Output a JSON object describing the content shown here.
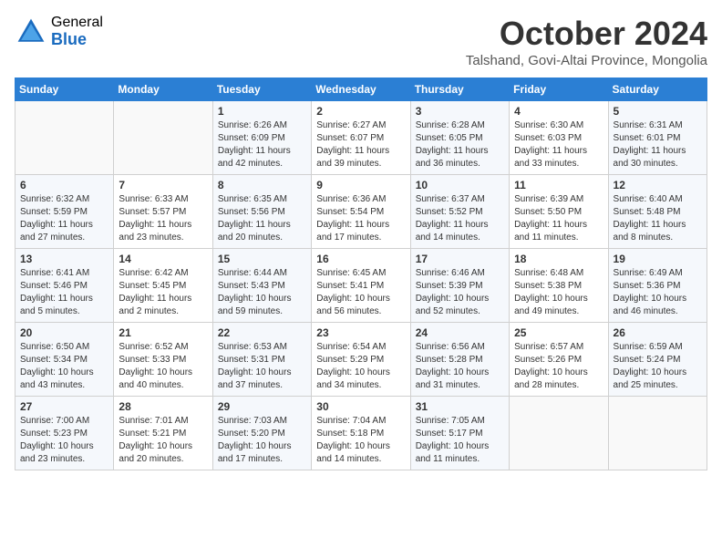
{
  "logo": {
    "general": "General",
    "blue": "Blue"
  },
  "title": "October 2024",
  "location": "Talshand, Govi-Altai Province, Mongolia",
  "headers": [
    "Sunday",
    "Monday",
    "Tuesday",
    "Wednesday",
    "Thursday",
    "Friday",
    "Saturday"
  ],
  "weeks": [
    [
      {
        "day": "",
        "info": ""
      },
      {
        "day": "",
        "info": ""
      },
      {
        "day": "1",
        "sunrise": "6:26 AM",
        "sunset": "6:09 PM",
        "daylight": "11 hours and 42 minutes."
      },
      {
        "day": "2",
        "sunrise": "6:27 AM",
        "sunset": "6:07 PM",
        "daylight": "11 hours and 39 minutes."
      },
      {
        "day": "3",
        "sunrise": "6:28 AM",
        "sunset": "6:05 PM",
        "daylight": "11 hours and 36 minutes."
      },
      {
        "day": "4",
        "sunrise": "6:30 AM",
        "sunset": "6:03 PM",
        "daylight": "11 hours and 33 minutes."
      },
      {
        "day": "5",
        "sunrise": "6:31 AM",
        "sunset": "6:01 PM",
        "daylight": "11 hours and 30 minutes."
      }
    ],
    [
      {
        "day": "6",
        "sunrise": "6:32 AM",
        "sunset": "5:59 PM",
        "daylight": "11 hours and 27 minutes."
      },
      {
        "day": "7",
        "sunrise": "6:33 AM",
        "sunset": "5:57 PM",
        "daylight": "11 hours and 23 minutes."
      },
      {
        "day": "8",
        "sunrise": "6:35 AM",
        "sunset": "5:56 PM",
        "daylight": "11 hours and 20 minutes."
      },
      {
        "day": "9",
        "sunrise": "6:36 AM",
        "sunset": "5:54 PM",
        "daylight": "11 hours and 17 minutes."
      },
      {
        "day": "10",
        "sunrise": "6:37 AM",
        "sunset": "5:52 PM",
        "daylight": "11 hours and 14 minutes."
      },
      {
        "day": "11",
        "sunrise": "6:39 AM",
        "sunset": "5:50 PM",
        "daylight": "11 hours and 11 minutes."
      },
      {
        "day": "12",
        "sunrise": "6:40 AM",
        "sunset": "5:48 PM",
        "daylight": "11 hours and 8 minutes."
      }
    ],
    [
      {
        "day": "13",
        "sunrise": "6:41 AM",
        "sunset": "5:46 PM",
        "daylight": "11 hours and 5 minutes."
      },
      {
        "day": "14",
        "sunrise": "6:42 AM",
        "sunset": "5:45 PM",
        "daylight": "11 hours and 2 minutes."
      },
      {
        "day": "15",
        "sunrise": "6:44 AM",
        "sunset": "5:43 PM",
        "daylight": "10 hours and 59 minutes."
      },
      {
        "day": "16",
        "sunrise": "6:45 AM",
        "sunset": "5:41 PM",
        "daylight": "10 hours and 56 minutes."
      },
      {
        "day": "17",
        "sunrise": "6:46 AM",
        "sunset": "5:39 PM",
        "daylight": "10 hours and 52 minutes."
      },
      {
        "day": "18",
        "sunrise": "6:48 AM",
        "sunset": "5:38 PM",
        "daylight": "10 hours and 49 minutes."
      },
      {
        "day": "19",
        "sunrise": "6:49 AM",
        "sunset": "5:36 PM",
        "daylight": "10 hours and 46 minutes."
      }
    ],
    [
      {
        "day": "20",
        "sunrise": "6:50 AM",
        "sunset": "5:34 PM",
        "daylight": "10 hours and 43 minutes."
      },
      {
        "day": "21",
        "sunrise": "6:52 AM",
        "sunset": "5:33 PM",
        "daylight": "10 hours and 40 minutes."
      },
      {
        "day": "22",
        "sunrise": "6:53 AM",
        "sunset": "5:31 PM",
        "daylight": "10 hours and 37 minutes."
      },
      {
        "day": "23",
        "sunrise": "6:54 AM",
        "sunset": "5:29 PM",
        "daylight": "10 hours and 34 minutes."
      },
      {
        "day": "24",
        "sunrise": "6:56 AM",
        "sunset": "5:28 PM",
        "daylight": "10 hours and 31 minutes."
      },
      {
        "day": "25",
        "sunrise": "6:57 AM",
        "sunset": "5:26 PM",
        "daylight": "10 hours and 28 minutes."
      },
      {
        "day": "26",
        "sunrise": "6:59 AM",
        "sunset": "5:24 PM",
        "daylight": "10 hours and 25 minutes."
      }
    ],
    [
      {
        "day": "27",
        "sunrise": "7:00 AM",
        "sunset": "5:23 PM",
        "daylight": "10 hours and 23 minutes."
      },
      {
        "day": "28",
        "sunrise": "7:01 AM",
        "sunset": "5:21 PM",
        "daylight": "10 hours and 20 minutes."
      },
      {
        "day": "29",
        "sunrise": "7:03 AM",
        "sunset": "5:20 PM",
        "daylight": "10 hours and 17 minutes."
      },
      {
        "day": "30",
        "sunrise": "7:04 AM",
        "sunset": "5:18 PM",
        "daylight": "10 hours and 14 minutes."
      },
      {
        "day": "31",
        "sunrise": "7:05 AM",
        "sunset": "5:17 PM",
        "daylight": "10 hours and 11 minutes."
      },
      {
        "day": "",
        "info": ""
      },
      {
        "day": "",
        "info": ""
      }
    ]
  ]
}
